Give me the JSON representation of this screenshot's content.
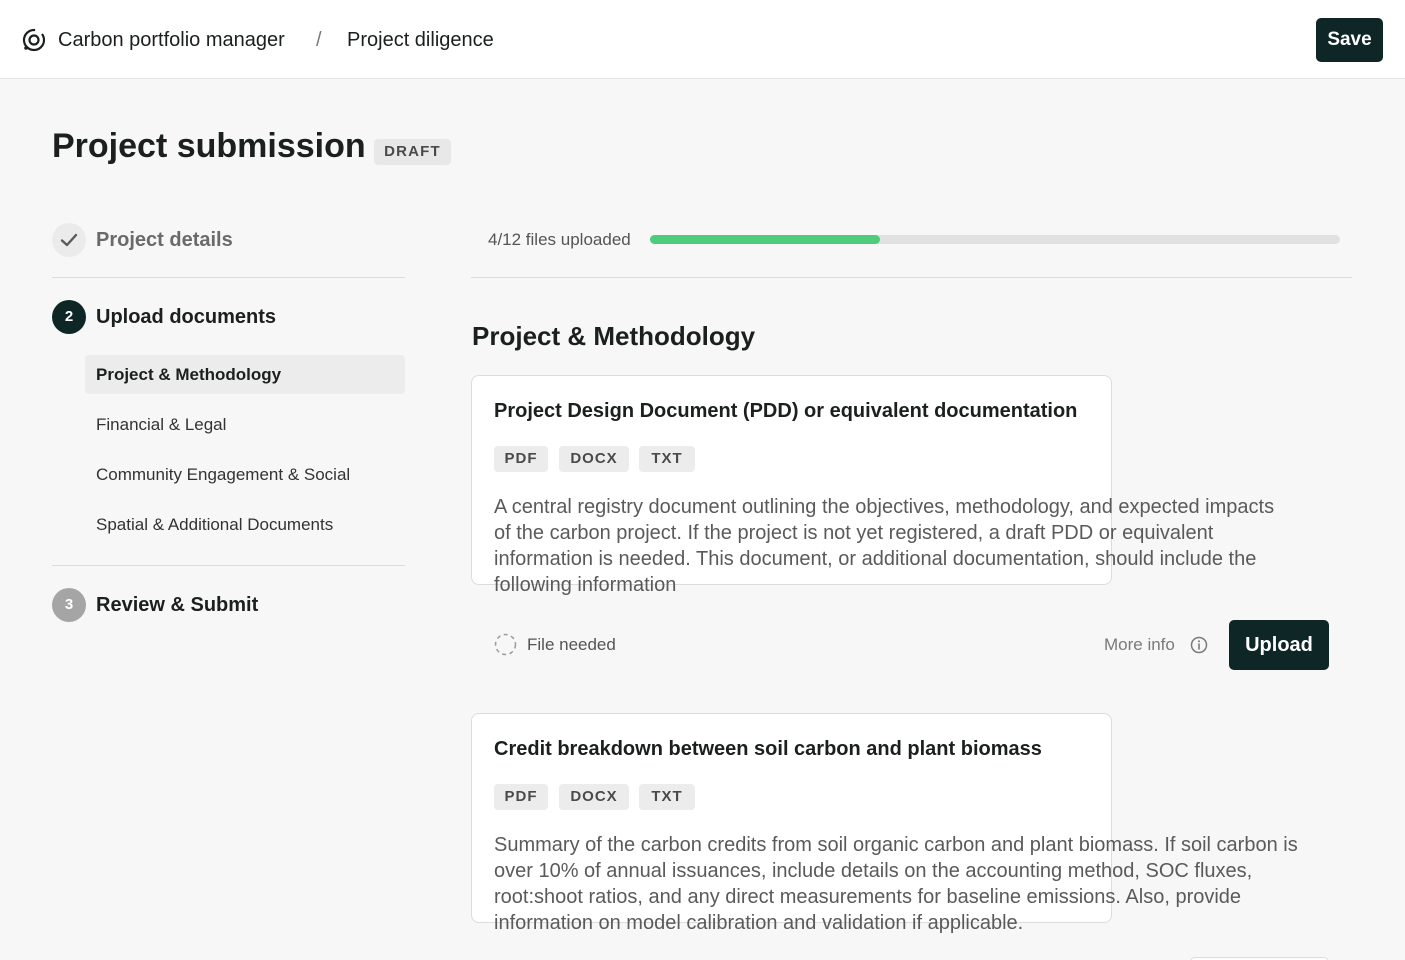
{
  "header": {
    "app_name": "Carbon portfolio manager",
    "separator": "/",
    "breadcrumb_current": "Project diligence",
    "save_label": "Save"
  },
  "page": {
    "title": "Project submission",
    "status_badge": "DRAFT"
  },
  "stepper": {
    "steps": [
      {
        "number": "",
        "label": "Project details",
        "state": "completed"
      },
      {
        "number": "2",
        "label": "Upload documents",
        "state": "active"
      },
      {
        "number": "3",
        "label": "Review & Submit",
        "state": "pending"
      }
    ],
    "sub_items": [
      {
        "label": "Project & Methodology",
        "selected": true
      },
      {
        "label": "Financial & Legal",
        "selected": false
      },
      {
        "label": "Community Engagement & Social",
        "selected": false
      },
      {
        "label": "Spatial & Additional Documents",
        "selected": false
      }
    ]
  },
  "progress": {
    "label": "4/12 files uploaded",
    "uploaded": 4,
    "total": 12,
    "color": "#4fcb7c"
  },
  "section": {
    "title": "Project & Methodology"
  },
  "documents": [
    {
      "title": "Project Design Document (PDD) or equivalent documentation",
      "types": [
        "PDF",
        "DOCX",
        "TXT"
      ],
      "description_lines": [
        "A central registry document outlining the objectives, methodology, and expected impacts",
        "of the carbon project. If the project is not yet registered, a draft PDD or equivalent",
        "information is needed. This document, or additional documentation, should include the",
        "following information"
      ],
      "status": "File needed",
      "more_info_label": "More info",
      "upload_label": "Upload"
    },
    {
      "title": "Credit breakdown between soil carbon and plant biomass",
      "types": [
        "PDF",
        "DOCX",
        "TXT"
      ],
      "description_lines": [
        "Summary of the carbon credits from soil organic carbon and plant biomass. If soil carbon is",
        "over 10% of annual issuances, include details on the accounting method, SOC fluxes,",
        "root:shoot ratios, and any direct measurements for baseline emissions. Also, provide",
        "information on model calibration and validation if applicable."
      ]
    }
  ],
  "colors": {
    "primary": "#0e2626",
    "progress": "#4fcb7c",
    "background": "#f7f7f7"
  },
  "icons": {
    "logo": "app-logo-icon",
    "step_completed": "checkmark-icon",
    "file_status": "dashed-circle-icon",
    "more_info": "info-circle-icon"
  }
}
